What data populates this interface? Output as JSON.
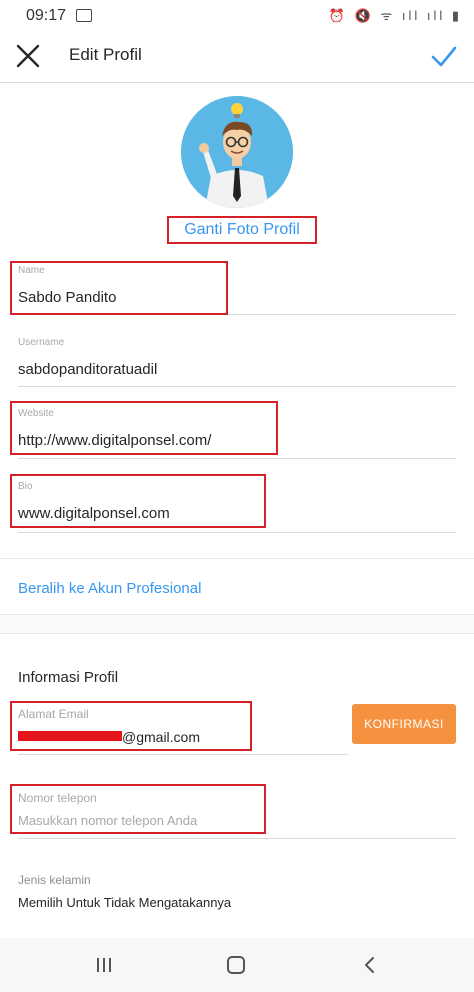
{
  "status_bar": {
    "time": "09:17",
    "right_icons": "⏰ 🔇 ᯤ ıll ıll ▮"
  },
  "app_bar": {
    "title": "Edit Profil"
  },
  "profile_photo": {
    "change_label": "Ganti Foto Profil"
  },
  "fields": {
    "name": {
      "label": "Name",
      "value": "Sabdo Pandito"
    },
    "username": {
      "label": "Username",
      "value": "sabdopanditoratuadil"
    },
    "website": {
      "label": "Website",
      "value": "http://www.digitalponsel.com/"
    },
    "bio": {
      "label": "Bio",
      "value": "www.digitalponsel.com"
    }
  },
  "pro_account_link": "Beralih ke Akun Profesional",
  "profile_info": {
    "heading": "Informasi Profil",
    "email": {
      "label": "Alamat Email",
      "value": "@gmail.com"
    },
    "confirm_button": "KONFIRMASI",
    "phone": {
      "label": "Nomor telepon",
      "placeholder": "Masukkan nomor telepon Anda"
    },
    "gender": {
      "label": "Jenis kelamin",
      "value": "Memilih Untuk Tidak Mengatakannya"
    }
  },
  "colors": {
    "accent": "#3897f0",
    "highlight_box": "#d42027",
    "confirm_button": "#f6913f",
    "redaction": "#e3141a"
  }
}
